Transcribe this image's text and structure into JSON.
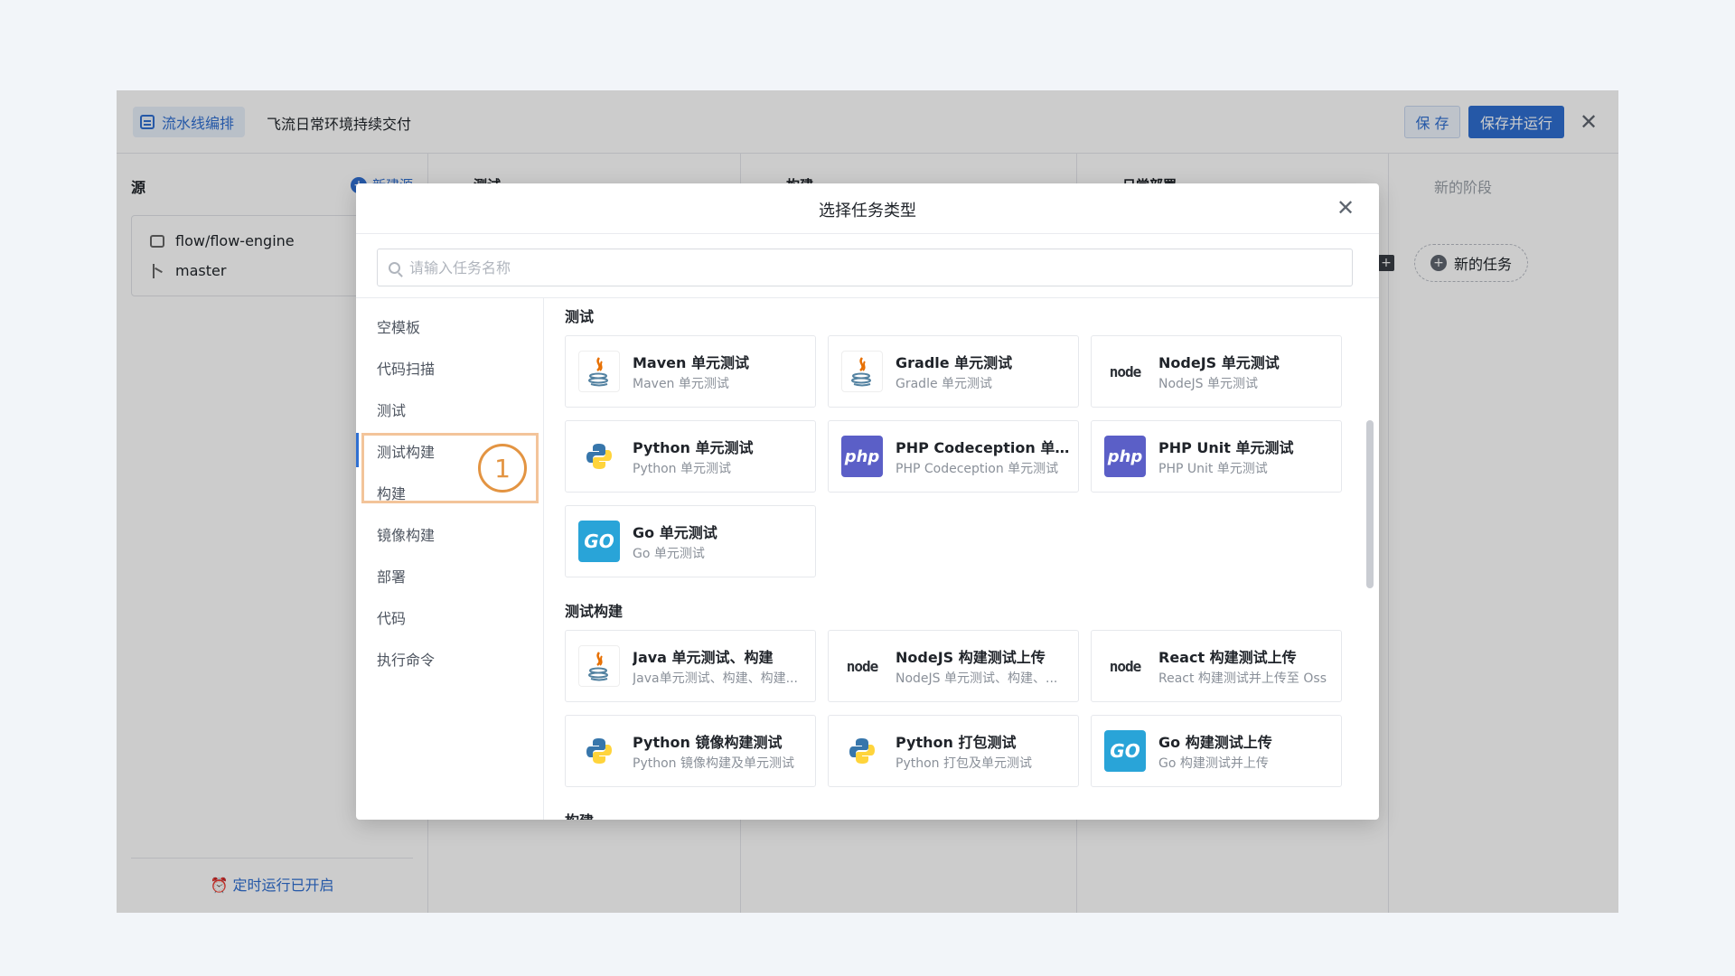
{
  "topbar": {
    "tab_label": "流水线编排",
    "pipeline_name": "飞流日常环境持续交付",
    "save_label": "保 存",
    "save_run_label": "保存并运行",
    "close_glyph": "✕"
  },
  "source": {
    "title": "源",
    "new_source_label": "新建源",
    "repo": "flow/flow-engine",
    "branch": "master",
    "schedule_label": "定时运行已开启"
  },
  "stages": [
    {
      "title": "测试"
    },
    {
      "title": "构建"
    },
    {
      "title": "日常部署"
    },
    {
      "title": "新的阶段"
    }
  ],
  "new_task_label": "新的任务",
  "modal": {
    "title": "选择任务类型",
    "close_glyph": "✕",
    "search_placeholder": "请输入任务名称",
    "categories": [
      "空模板",
      "代码扫描",
      "测试",
      "测试构建",
      "构建",
      "镜像构建",
      "部署",
      "代码",
      "执行命令"
    ],
    "callout_number": "1",
    "sections": [
      {
        "title": "测试",
        "cards": [
          {
            "name": "Maven 单元测试",
            "desc": "Maven 单元测试",
            "icon": "java-icon"
          },
          {
            "name": "Gradle 单元测试",
            "desc": "Gradle 单元测试",
            "icon": "java-icon"
          },
          {
            "name": "NodeJS 单元测试",
            "desc": "NodeJS 单元测试",
            "icon": "node-icon"
          },
          {
            "name": "Python 单元测试",
            "desc": "Python 单元测试",
            "icon": "python-icon"
          },
          {
            "name": "PHP Codeception 单元...",
            "desc": "PHP Codeception 单元测试",
            "icon": "php-icon"
          },
          {
            "name": "PHP Unit 单元测试",
            "desc": "PHP Unit 单元测试",
            "icon": "php-icon"
          },
          {
            "name": "Go 单元测试",
            "desc": "Go 单元测试",
            "icon": "go-icon"
          }
        ]
      },
      {
        "title": "测试构建",
        "cards": [
          {
            "name": "Java 单元测试、构建",
            "desc": "Java单元测试、构建、构建...",
            "icon": "java-icon"
          },
          {
            "name": "NodeJS 构建测试上传",
            "desc": "NodeJS 单元测试、构建、...",
            "icon": "node-icon"
          },
          {
            "name": "React 构建测试上传",
            "desc": "React 构建测试并上传至 Oss",
            "icon": "node-icon"
          },
          {
            "name": "Python 镜像构建测试",
            "desc": "Python 镜像构建及单元测试",
            "icon": "python-icon"
          },
          {
            "name": "Python 打包测试",
            "desc": "Python 打包及单元测试",
            "icon": "python-icon"
          },
          {
            "name": "Go 构建测试上传",
            "desc": "Go 构建测试并上传",
            "icon": "go-icon"
          }
        ]
      },
      {
        "title": "构建",
        "cards": []
      }
    ]
  },
  "icon_text": {
    "node": "node",
    "php": "php",
    "go": "GO"
  },
  "colors": {
    "accent": "#2f6fd1",
    "callout": "#e39442",
    "php": "#5b5fc7",
    "go": "#29a4d8"
  }
}
